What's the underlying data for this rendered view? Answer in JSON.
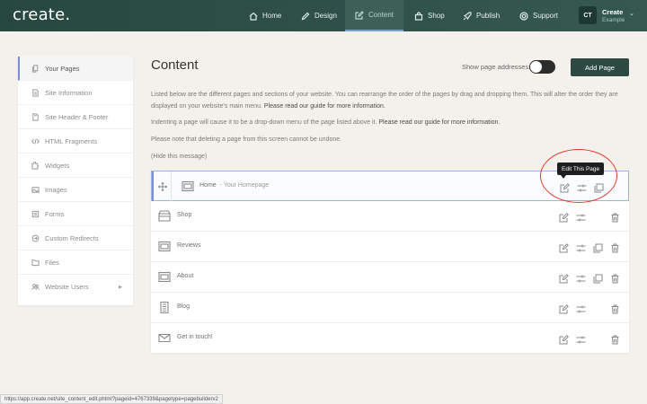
{
  "app": {
    "logo": "create."
  },
  "nav": {
    "items": [
      {
        "label": "Home",
        "icon": "home-icon"
      },
      {
        "label": "Design",
        "icon": "pencil-icon"
      },
      {
        "label": "Content",
        "icon": "edit-box-icon",
        "active": true
      },
      {
        "label": "Shop",
        "icon": "shopping-bag-icon"
      },
      {
        "label": "Publish",
        "icon": "rocket-icon"
      },
      {
        "label": "Support",
        "icon": "lifebuoy-icon"
      }
    ],
    "account": {
      "initials": "CT",
      "name": "Create",
      "sub": "Example"
    }
  },
  "sidebar": {
    "items": [
      {
        "label": "Your Pages",
        "icon": "pages-icon",
        "active": true
      },
      {
        "label": "Site Information",
        "icon": "info-page-icon"
      },
      {
        "label": "Site Header & Footer",
        "icon": "header-footer-icon"
      },
      {
        "label": "HTML Fragments",
        "icon": "code-icon"
      },
      {
        "label": "Widgets",
        "icon": "widget-icon"
      },
      {
        "label": "Images",
        "icon": "image-icon"
      },
      {
        "label": "Forms",
        "icon": "form-icon"
      },
      {
        "label": "Custom Redirects",
        "icon": "redirect-icon"
      },
      {
        "label": "Files",
        "icon": "folder-icon"
      },
      {
        "label": "Website Users",
        "icon": "users-icon",
        "has_submenu": true
      }
    ]
  },
  "main": {
    "title": "Content",
    "show_addresses_label": "Show page addresses:",
    "show_addresses_on": false,
    "add_page_label": "Add Page",
    "para1_text": "Listed below are the different pages and sections of your website. You can rearrange the order of the pages by drag and dropping them. This will alter the order they are displayed on your website's main menu. ",
    "para1_link": "Please read our guide for more information.",
    "para2_text": "Indenting a page will cause it to be a drop-down menu of the page listed above it. ",
    "para2_link": "Please read our guide for more information.",
    "para3_text": "Please note that deleting a page from this screen cannot be undone.",
    "hide_message": "(Hide this message)",
    "tooltip": "Edit This Page"
  },
  "pages": [
    {
      "name": "Home",
      "sub": "- Your Homepage",
      "icon": "page-layout-icon",
      "selected": true,
      "actions": [
        "edit",
        "settings",
        "duplicate"
      ]
    },
    {
      "name": "Shop",
      "sub": "",
      "icon": "shop-icon",
      "actions": [
        "edit",
        "settings",
        "delete"
      ]
    },
    {
      "name": "Reviews",
      "sub": "",
      "icon": "page-layout-icon",
      "actions": [
        "edit",
        "settings",
        "duplicate",
        "delete"
      ]
    },
    {
      "name": "About",
      "sub": "",
      "icon": "page-layout-icon",
      "actions": [
        "edit",
        "settings",
        "duplicate",
        "delete"
      ]
    },
    {
      "name": "Blog",
      "sub": "",
      "icon": "blog-icon",
      "actions": [
        "edit",
        "settings",
        "delete"
      ]
    },
    {
      "name": "Get in touch!",
      "sub": "",
      "icon": "envelope-icon",
      "actions": [
        "edit",
        "settings",
        "delete"
      ]
    }
  ],
  "status_url": "https://app.create.net/site_content_edit.phtml?pageid=4767339&pagetype=pagebuilderv2",
  "colors": {
    "topbar": "#2f514a",
    "accent": "#7c8fe0",
    "button": "#2c4a42",
    "annotation": "#e23b32"
  }
}
